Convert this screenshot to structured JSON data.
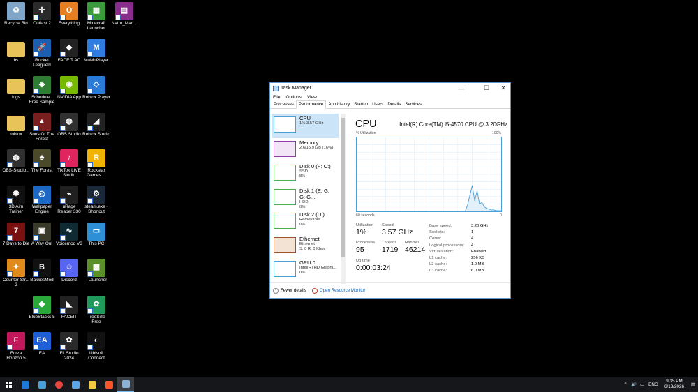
{
  "desktop": {
    "icons": [
      {
        "label": "Recycle Bin",
        "icon": "recycle-bin-icon",
        "color": "#7fa6c9",
        "col": 0,
        "row": 0,
        "glyph": "♻"
      },
      {
        "label": "Outlast 2",
        "icon": "outlast-icon",
        "color": "#2a2a2a",
        "col": 1,
        "row": 0,
        "glyph": "✛"
      },
      {
        "label": "Everything",
        "icon": "everything-search-icon",
        "color": "#e67e22",
        "col": 2,
        "row": 0,
        "glyph": "O"
      },
      {
        "label": "Minecraft Launcher",
        "icon": "minecraft-icon",
        "color": "#3a9b3a",
        "col": 3,
        "row": 0,
        "glyph": "▦"
      },
      {
        "label": "Natro_Mac...",
        "icon": "winrar-icon",
        "color": "#8a2b8e",
        "col": 4,
        "row": 0,
        "glyph": "▤"
      },
      {
        "label": "bs",
        "icon": "folder-icon",
        "color": "#e8c35a",
        "col": 0,
        "row": 1,
        "glyph": ""
      },
      {
        "label": "Rocket League®",
        "icon": "rocket-league-icon",
        "color": "#1c5fb0",
        "col": 1,
        "row": 1,
        "glyph": "🚀"
      },
      {
        "label": "FACEIT AC",
        "icon": "faceit-ac-icon",
        "color": "#222",
        "col": 2,
        "row": 1,
        "glyph": "◆"
      },
      {
        "label": "MuMuPlayer",
        "icon": "mumu-icon",
        "color": "#2f7de1",
        "col": 3,
        "row": 1,
        "glyph": "M"
      },
      {
        "label": "logs",
        "icon": "folder-icon",
        "color": "#e8c35a",
        "col": 0,
        "row": 2,
        "glyph": ""
      },
      {
        "label": "Schedule I Free Sample",
        "icon": "schedule-icon",
        "color": "#2e7d32",
        "col": 1,
        "row": 2,
        "glyph": "◈"
      },
      {
        "label": "NVIDIA App",
        "icon": "nvidia-icon",
        "color": "#76b900",
        "col": 2,
        "row": 2,
        "glyph": "◉"
      },
      {
        "label": "Roblox Player",
        "icon": "roblox-player-icon",
        "color": "#2a7bd8",
        "col": 3,
        "row": 2,
        "glyph": "◇"
      },
      {
        "label": "roblox",
        "icon": "folder-icon",
        "color": "#e8c35a",
        "col": 0,
        "row": 3,
        "glyph": ""
      },
      {
        "label": "Sons Of The Forest",
        "icon": "sons-forest-icon",
        "color": "#7a1f1f",
        "col": 1,
        "row": 3,
        "glyph": "▲"
      },
      {
        "label": "OBS Studio",
        "icon": "obs-icon",
        "color": "#303030",
        "col": 2,
        "row": 3,
        "glyph": "◍"
      },
      {
        "label": "Roblox Studio",
        "icon": "roblox-studio-icon",
        "color": "#222",
        "col": 3,
        "row": 3,
        "glyph": "◢"
      },
      {
        "label": "OBS-Studio...",
        "icon": "obs-icon",
        "color": "#303030",
        "col": 0,
        "row": 4,
        "glyph": "◍"
      },
      {
        "label": "The Forest",
        "icon": "the-forest-icon",
        "color": "#4a4a2a",
        "col": 1,
        "row": 4,
        "glyph": "♣"
      },
      {
        "label": "TikTok LIVE Studio",
        "icon": "tiktok-icon",
        "color": "#e0245e",
        "col": 2,
        "row": 4,
        "glyph": "♪"
      },
      {
        "label": "Rockstar Games ...",
        "icon": "rockstar-icon",
        "color": "#f0b400",
        "col": 3,
        "row": 4,
        "glyph": "R"
      },
      {
        "label": "3D Aim Trainer",
        "icon": "aim-trainer-icon",
        "color": "#111",
        "col": 0,
        "row": 5,
        "glyph": "✺"
      },
      {
        "label": "Wallpaper Engine",
        "icon": "wallpaper-engine-icon",
        "color": "#1d68c4",
        "col": 1,
        "row": 5,
        "glyph": "◎"
      },
      {
        "label": "uRage Reaper 330",
        "icon": "urage-icon",
        "color": "#202020",
        "col": 2,
        "row": 5,
        "glyph": "⌁"
      },
      {
        "label": "steam.exe - Shortcut",
        "icon": "steam-icon",
        "color": "#1b2838",
        "col": 3,
        "row": 5,
        "glyph": "⚙"
      },
      {
        "label": "7 Days to Die",
        "icon": "seven-days-icon",
        "color": "#7a1010",
        "col": 0,
        "row": 6,
        "glyph": "7"
      },
      {
        "label": "A Way Out",
        "icon": "a-way-out-icon",
        "color": "#3a3a2a",
        "col": 1,
        "row": 6,
        "glyph": "▣"
      },
      {
        "label": "Voicemod V3",
        "icon": "voicemod-icon",
        "color": "#0f2a33",
        "col": 2,
        "row": 6,
        "glyph": "∿"
      },
      {
        "label": "This PC",
        "icon": "this-pc-icon",
        "color": "#2d8fd6",
        "col": 3,
        "row": 6,
        "glyph": "▭"
      },
      {
        "label": "Counter-Str... 2",
        "icon": "cs2-icon",
        "color": "#e08a1e",
        "col": 0,
        "row": 7,
        "glyph": "✦"
      },
      {
        "label": "BakkesMod",
        "icon": "bakkesmod-icon",
        "color": "#111",
        "col": 1,
        "row": 7,
        "glyph": "B"
      },
      {
        "label": "Discord",
        "icon": "discord-icon",
        "color": "#5865f2",
        "col": 2,
        "row": 7,
        "glyph": "☺"
      },
      {
        "label": "TLauncher",
        "icon": "tlauncher-icon",
        "color": "#5a8f2a",
        "col": 3,
        "row": 7,
        "glyph": "▩"
      },
      {
        "label": "BlueStacks 5",
        "icon": "bluestacks-icon",
        "color": "#2aa83a",
        "col": 1,
        "row": 8,
        "glyph": "◆"
      },
      {
        "label": "FACEIT",
        "icon": "faceit-icon",
        "color": "#222",
        "col": 2,
        "row": 8,
        "glyph": "◣"
      },
      {
        "label": "TreeSize Free",
        "icon": "treesize-icon",
        "color": "#1f9a5a",
        "col": 3,
        "row": 8,
        "glyph": "✿"
      },
      {
        "label": "Forza Horizon 5",
        "icon": "forza-icon",
        "color": "#c2185b",
        "col": 0,
        "row": 9,
        "glyph": "F"
      },
      {
        "label": "EA",
        "icon": "ea-icon",
        "color": "#1f5fd6",
        "col": 1,
        "row": 9,
        "glyph": "EA"
      },
      {
        "label": "FL Studio 2024",
        "icon": "fl-studio-icon",
        "color": "#2a2a2a",
        "col": 2,
        "row": 9,
        "glyph": "✿"
      },
      {
        "label": "Ubisoft Connect",
        "icon": "ubisoft-icon",
        "color": "#111",
        "col": 3,
        "row": 9,
        "glyph": "◐"
      }
    ]
  },
  "taskmanager": {
    "title": "Task Manager",
    "menu": [
      "File",
      "Options",
      "View"
    ],
    "tabs": [
      "Processes",
      "Performance",
      "App history",
      "Startup",
      "Users",
      "Details",
      "Services"
    ],
    "active_tab": "Performance",
    "resources": [
      {
        "name": "CPU",
        "sub1": "1%  3.57 GHz",
        "sub2": "",
        "color": "#4a9fd8",
        "selected": true
      },
      {
        "name": "Memory",
        "sub1": "2.6/15.9 GB (16%)",
        "sub2": "",
        "color": "#8b3fa8",
        "selected": false
      },
      {
        "name": "Disk 0 (F: C:)",
        "sub1": "SSD",
        "sub2": "8%",
        "color": "#4caf50",
        "selected": false
      },
      {
        "name": "Disk 1 (E: G: G: G...",
        "sub1": "HDD",
        "sub2": "0%",
        "color": "#4caf50",
        "selected": false
      },
      {
        "name": "Disk 2 (D:)",
        "sub1": "Removable",
        "sub2": "0%",
        "color": "#4caf50",
        "selected": false
      },
      {
        "name": "Ethernet",
        "sub1": "Ethernet",
        "sub2": "S: 0  R: 0 Kbps",
        "color": "#a0522d",
        "selected": false
      },
      {
        "name": "GPU 0",
        "sub1": "Intel(R) HD Graphi...",
        "sub2": "0%",
        "color": "#4a9fd8",
        "selected": false
      }
    ],
    "cpu": {
      "heading": "CPU",
      "model": "Intel(R) Core(TM) i5-4570 CPU @ 3.20GHz",
      "graph_label": "% Utilization",
      "graph_max": "100%",
      "graph_left": "60 seconds",
      "graph_right": "0",
      "utilization_label": "Utilization",
      "utilization": "1%",
      "speed_label": "Speed",
      "speed": "3.57 GHz",
      "processes_label": "Processes",
      "processes": "95",
      "threads_label": "Threads",
      "threads": "1719",
      "handles_label": "Handles",
      "handles": "46214",
      "uptime_label": "Up time",
      "uptime": "0:00:03:24",
      "specs": [
        {
          "k": "Base speed:",
          "v": "3.20 GHz"
        },
        {
          "k": "Sockets:",
          "v": "1"
        },
        {
          "k": "Cores:",
          "v": "4"
        },
        {
          "k": "Logical processors:",
          "v": "4"
        },
        {
          "k": "Virtualization:",
          "v": "Enabled"
        },
        {
          "k": "L1 cache:",
          "v": "256 KB"
        },
        {
          "k": "L2 cache:",
          "v": "1.0 MB"
        },
        {
          "k": "L3 cache:",
          "v": "6.0 MB"
        }
      ],
      "history": [
        0,
        0,
        0,
        0,
        0,
        0,
        0,
        0,
        0,
        0,
        0,
        0,
        0,
        0,
        0,
        0,
        0,
        0,
        0,
        0,
        0,
        0,
        0,
        0,
        0,
        0,
        0,
        0,
        0,
        0,
        0,
        0,
        0,
        0,
        0,
        0,
        0,
        0,
        0,
        0,
        0,
        0,
        0,
        0,
        0,
        0,
        8,
        22,
        35,
        14,
        28,
        10,
        12,
        6,
        4,
        3,
        2,
        2,
        1,
        1,
        1
      ]
    },
    "footer": {
      "fewer": "Fewer details",
      "monitor": "Open Resource Monitor"
    }
  },
  "taskbar": {
    "time": "9:35 PM",
    "date": "6/13/2026",
    "lang": "ENG",
    "apps": [
      {
        "icon": "windows-start-icon",
        "color": "#ffffff"
      },
      {
        "icon": "outlook-icon",
        "color": "#1e78d4"
      },
      {
        "icon": "calendar-app-icon",
        "color": "#4a9fd8"
      },
      {
        "icon": "chrome-icon",
        "color": "#e8453c"
      },
      {
        "icon": "files-app-icon",
        "color": "#5aa6e6"
      },
      {
        "icon": "file-explorer-icon",
        "color": "#f2c744"
      },
      {
        "icon": "brave-icon",
        "color": "#fb542b"
      },
      {
        "icon": "task-manager-icon",
        "color": "#8ab4d6"
      }
    ]
  }
}
